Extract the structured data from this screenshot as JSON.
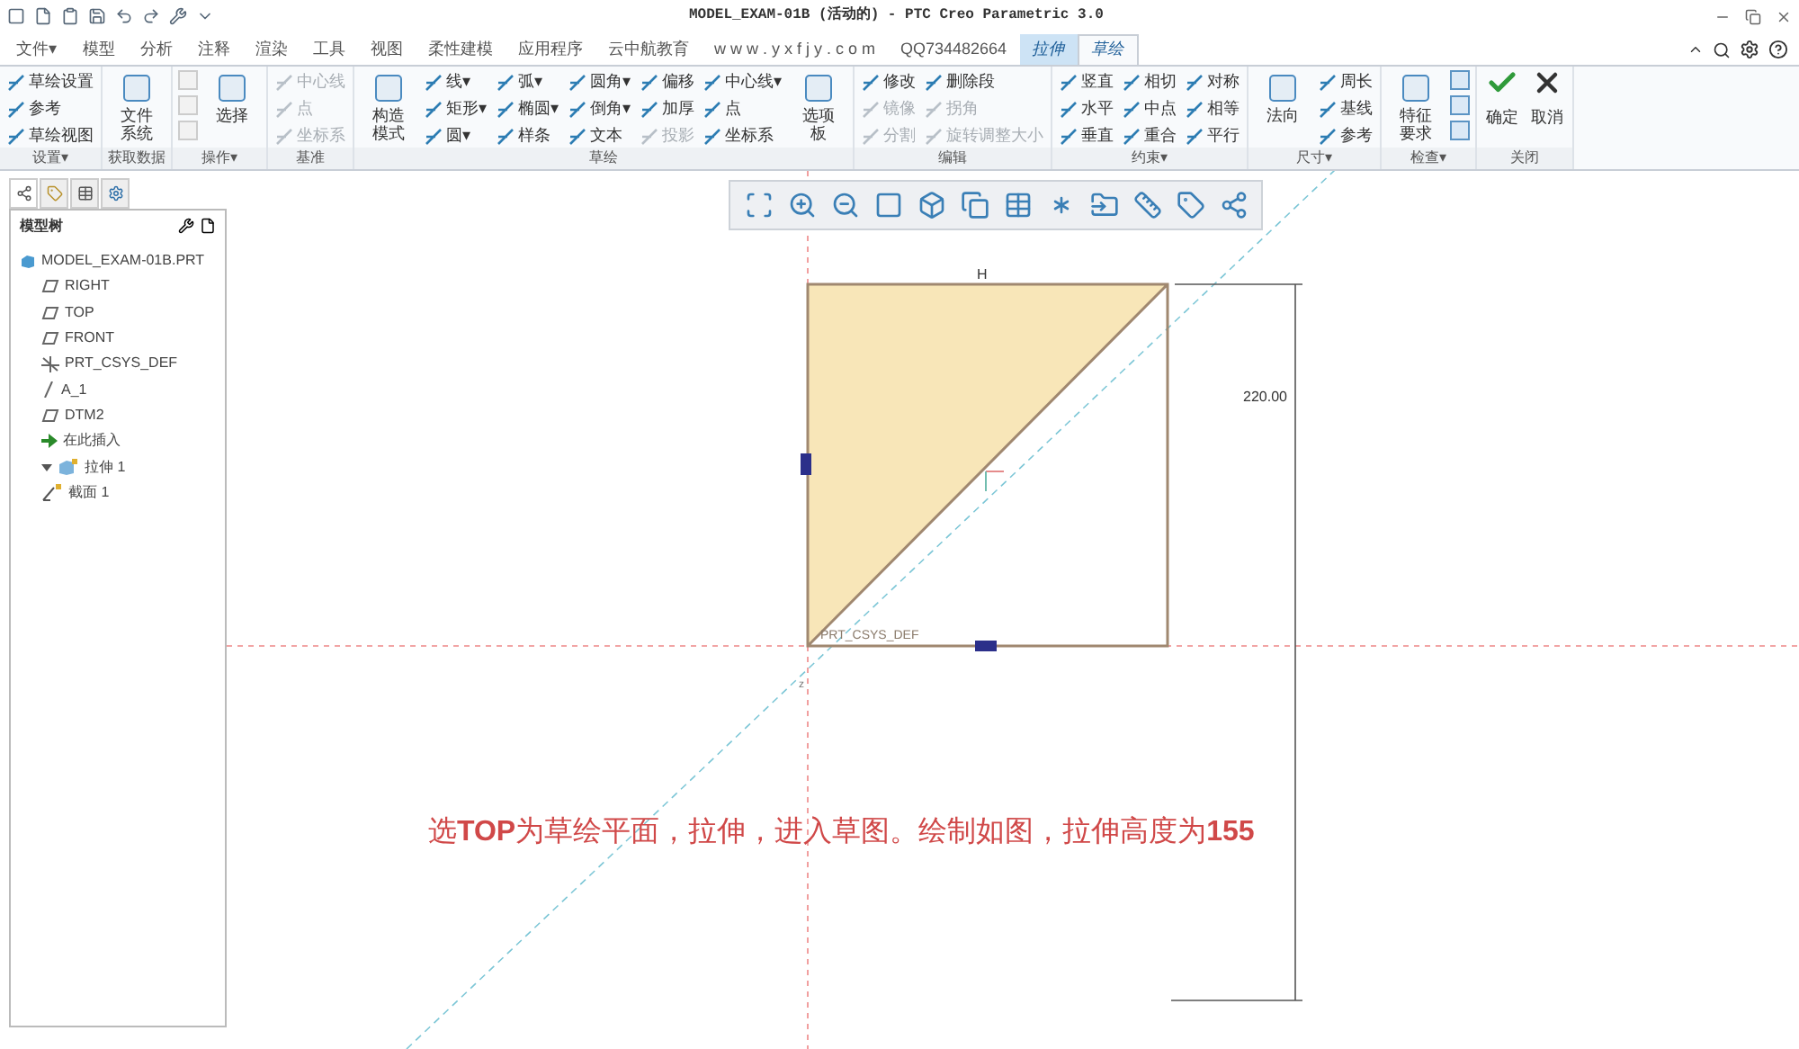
{
  "window": {
    "title": "MODEL_EXAM-01B (活动的) - PTC Creo Parametric 3.0"
  },
  "tabs": [
    {
      "label": "文件▾",
      "selected": false,
      "contextual": false
    },
    {
      "label": "模型",
      "selected": false,
      "contextual": false
    },
    {
      "label": "分析",
      "selected": false,
      "contextual": false
    },
    {
      "label": "注释",
      "selected": false,
      "contextual": false
    },
    {
      "label": "渲染",
      "selected": false,
      "contextual": false
    },
    {
      "label": "工具",
      "selected": false,
      "contextual": false
    },
    {
      "label": "视图",
      "selected": false,
      "contextual": false
    },
    {
      "label": "柔性建模",
      "selected": false,
      "contextual": false
    },
    {
      "label": "应用程序",
      "selected": false,
      "contextual": false
    },
    {
      "label": "云中航教育",
      "selected": false,
      "contextual": false
    },
    {
      "label": "w w w . y x f j y . c o m",
      "selected": false,
      "contextual": false
    },
    {
      "label": "QQ734482664",
      "selected": false,
      "contextual": false
    },
    {
      "label": "拉伸",
      "selected": false,
      "contextual": true
    },
    {
      "label": "草绘",
      "selected": true,
      "contextual": true
    }
  ],
  "ribbon": [
    {
      "label": "设置▾",
      "columns": [
        {
          "kind": "small",
          "items": [
            {
              "label": "草绘设置",
              "disabled": false
            },
            {
              "label": "参考",
              "disabled": false
            },
            {
              "label": "草绘视图",
              "disabled": false
            }
          ]
        }
      ]
    },
    {
      "label": "获取数据",
      "columns": [
        {
          "kind": "large",
          "items": [
            {
              "label": "文件系统",
              "disabled": false
            }
          ]
        }
      ]
    },
    {
      "label": "操作▾",
      "columns": [
        {
          "kind": "icons",
          "items": [
            {
              "disabled": true
            },
            {
              "disabled": true
            },
            {
              "disabled": true
            }
          ]
        },
        {
          "kind": "large",
          "items": [
            {
              "label": "选择",
              "disabled": false
            }
          ]
        }
      ]
    },
    {
      "label": "基准",
      "columns": [
        {
          "kind": "small",
          "items": [
            {
              "label": "中心线",
              "disabled": true
            },
            {
              "label": "点",
              "disabled": true
            },
            {
              "label": "坐标系",
              "disabled": true
            }
          ]
        }
      ]
    },
    {
      "label": "草绘",
      "columns": [
        {
          "kind": "large",
          "items": [
            {
              "label": "构造模式",
              "disabled": false
            }
          ]
        },
        {
          "kind": "small",
          "items": [
            {
              "label": "线▾",
              "disabled": false
            },
            {
              "label": "矩形▾",
              "disabled": false
            },
            {
              "label": "圆▾",
              "disabled": false
            }
          ]
        },
        {
          "kind": "small",
          "items": [
            {
              "label": "弧▾",
              "disabled": false
            },
            {
              "label": "椭圆▾",
              "disabled": false
            },
            {
              "label": "样条",
              "disabled": false
            }
          ]
        },
        {
          "kind": "small",
          "items": [
            {
              "label": "圆角▾",
              "disabled": false
            },
            {
              "label": "倒角▾",
              "disabled": false
            },
            {
              "label": "文本",
              "disabled": false
            }
          ]
        },
        {
          "kind": "small",
          "items": [
            {
              "label": "偏移",
              "disabled": false
            },
            {
              "label": "加厚",
              "disabled": false
            },
            {
              "label": "投影",
              "disabled": true
            }
          ]
        },
        {
          "kind": "small",
          "items": [
            {
              "label": "中心线▾",
              "disabled": false
            },
            {
              "label": "点",
              "disabled": false
            },
            {
              "label": "坐标系",
              "disabled": false
            }
          ]
        },
        {
          "kind": "large",
          "items": [
            {
              "label": "选项板",
              "disabled": false
            }
          ]
        }
      ]
    },
    {
      "label": "编辑",
      "columns": [
        {
          "kind": "small",
          "items": [
            {
              "label": "修改",
              "disabled": false
            },
            {
              "label": "镜像",
              "disabled": true
            },
            {
              "label": "分割",
              "disabled": true
            }
          ]
        },
        {
          "kind": "small",
          "items": [
            {
              "label": "删除段",
              "disabled": false
            },
            {
              "label": "拐角",
              "disabled": true
            },
            {
              "label": "旋转调整大小",
              "disabled": true
            }
          ]
        }
      ]
    },
    {
      "label": "约束▾",
      "columns": [
        {
          "kind": "small",
          "items": [
            {
              "label": "竖直",
              "disabled": false
            },
            {
              "label": "水平",
              "disabled": false
            },
            {
              "label": "垂直",
              "disabled": false
            }
          ]
        },
        {
          "kind": "small",
          "items": [
            {
              "label": "相切",
              "disabled": false
            },
            {
              "label": "中点",
              "disabled": false
            },
            {
              "label": "重合",
              "disabled": false
            }
          ]
        },
        {
          "kind": "small",
          "items": [
            {
              "label": "对称",
              "disabled": false
            },
            {
              "label": "相等",
              "disabled": false
            },
            {
              "label": "平行",
              "disabled": false
            }
          ]
        }
      ]
    },
    {
      "label": "尺寸▾",
      "columns": [
        {
          "kind": "large",
          "items": [
            {
              "label": "法向",
              "disabled": false
            }
          ]
        },
        {
          "kind": "small",
          "items": [
            {
              "label": "周长",
              "disabled": false
            },
            {
              "label": "基线",
              "disabled": false
            },
            {
              "label": "参考",
              "disabled": false
            }
          ]
        }
      ]
    },
    {
      "label": "检查▾",
      "columns": [
        {
          "kind": "large",
          "items": [
            {
              "label": "特征要求",
              "disabled": false
            }
          ]
        },
        {
          "kind": "icons",
          "items": [
            {
              "disabled": false
            },
            {
              "disabled": false
            },
            {
              "disabled": false
            }
          ]
        }
      ]
    },
    {
      "label": "关闭",
      "columns": [
        {
          "kind": "ok",
          "items": [
            {
              "label": "确定",
              "disabled": false
            }
          ]
        },
        {
          "kind": "cancel",
          "items": [
            {
              "label": "取消",
              "disabled": false
            }
          ]
        }
      ]
    }
  ],
  "model_tree": {
    "title": "模型树",
    "items": [
      {
        "label": "MODEL_EXAM-01B.PRT",
        "kind": "part"
      },
      {
        "label": "RIGHT",
        "kind": "plane"
      },
      {
        "label": "TOP",
        "kind": "plane"
      },
      {
        "label": "FRONT",
        "kind": "plane"
      },
      {
        "label": "PRT_CSYS_DEF",
        "kind": "csys"
      },
      {
        "label": "A_1",
        "kind": "axis"
      },
      {
        "label": "DTM2",
        "kind": "plane"
      },
      {
        "label": "在此插入",
        "kind": "insert"
      },
      {
        "label": "拉伸 1",
        "kind": "feature",
        "expanded": true,
        "children": [
          {
            "label": "截面 1",
            "kind": "sketch"
          }
        ]
      }
    ]
  },
  "sketch": {
    "top_label": "H",
    "dimension": "220.00",
    "csys_label": "PRT_CSYS_DEF",
    "axis_label": "z"
  },
  "caption": "选**TOP**为草绘平面，拉伸，进入草图。绘制如图，拉伸高度为**155**"
}
